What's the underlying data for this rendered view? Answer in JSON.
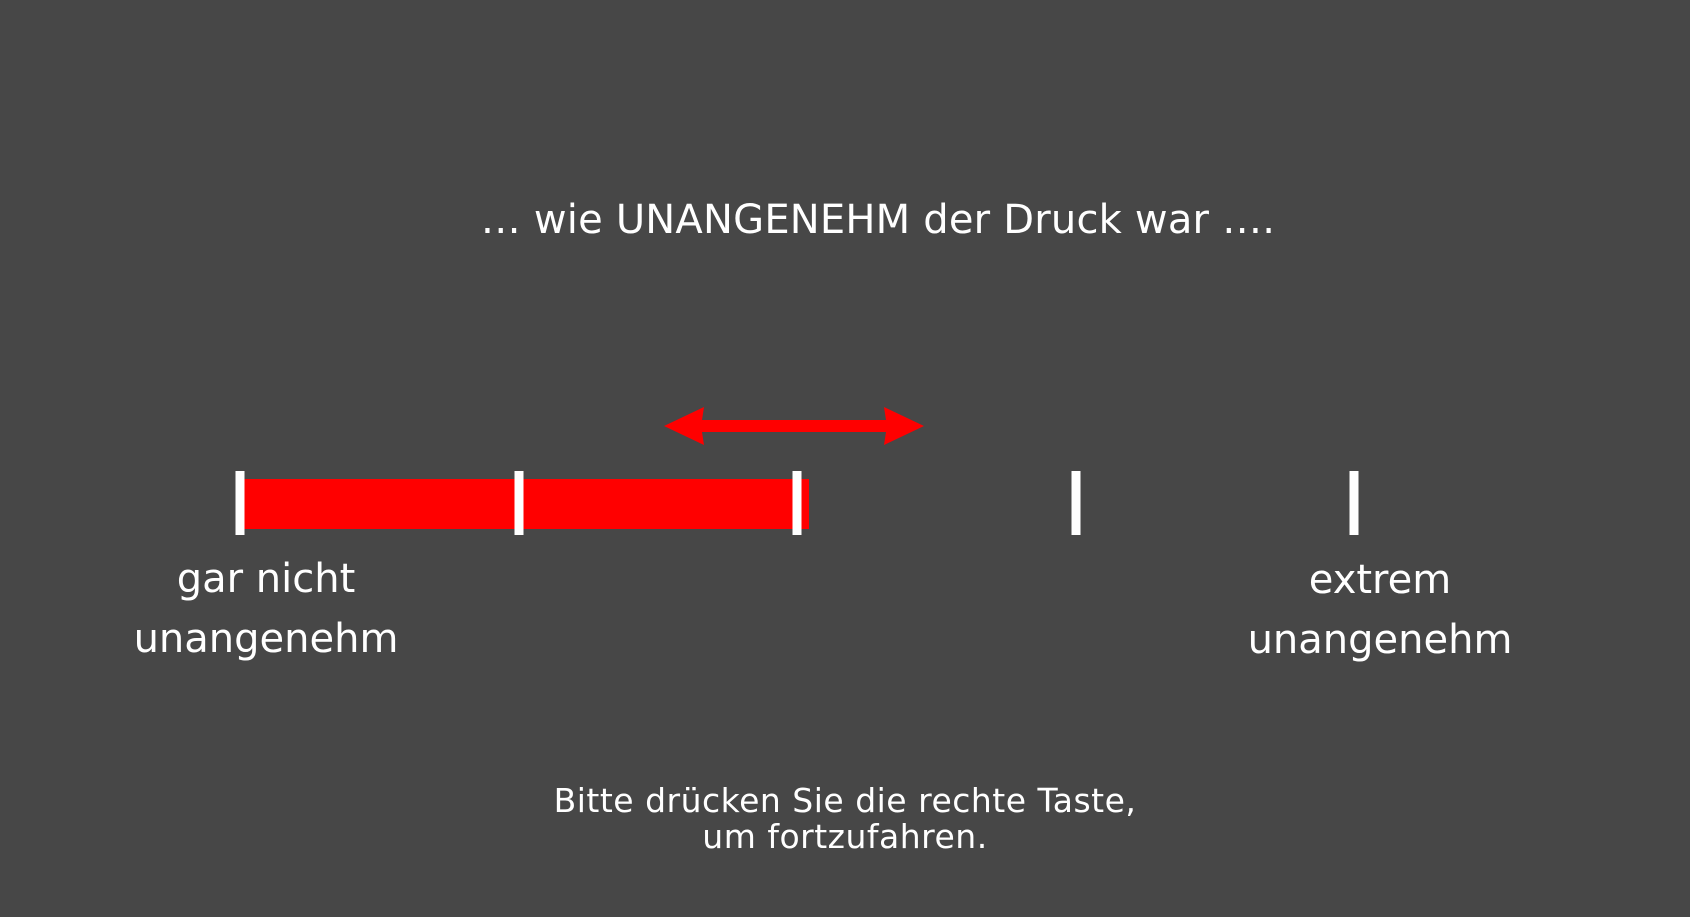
{
  "question": {
    "text": "… wie UNANGENEHM der Druck war …."
  },
  "scale": {
    "tick_count": 5,
    "value": 0.5,
    "fill_color": "#ff0000",
    "tick_color": "#ffffff",
    "background_color": "#474747",
    "left_anchor": {
      "line1": "gar nicht",
      "line2": "unangenehm"
    },
    "right_anchor": {
      "line1": "extrem",
      "line2": "unangenehm"
    },
    "cursor_icon": "double-arrow-icon"
  },
  "instructions": {
    "line1": "Bitte drücken Sie die rechte Taste,",
    "line2": "um fortzufahren."
  }
}
